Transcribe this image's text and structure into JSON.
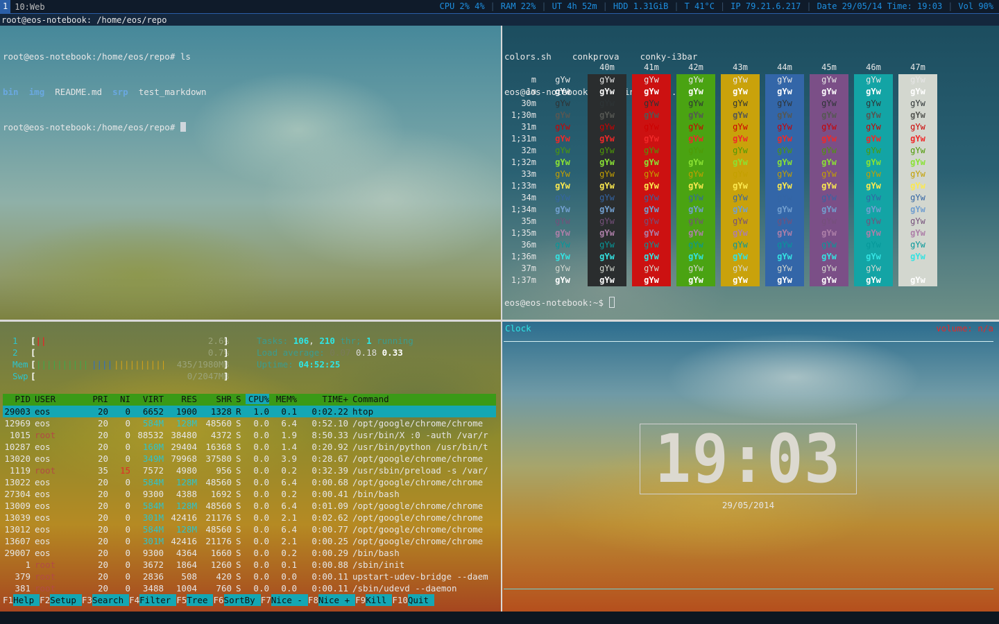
{
  "topbar": {
    "workspace_num": "1",
    "workspace_name": "10:Web",
    "status": [
      "CPU 2% 4%",
      "RAM 22%",
      "UT 4h 52m",
      "HDD 1.31GiB",
      "T 41°C",
      "IP 79.21.6.217",
      "Date 29/05/14 Time: 19:03",
      "Vol 90%"
    ],
    "separator": "|"
  },
  "titlebar": {
    "text": "root@eos-notebook: /home/eos/repo"
  },
  "term1": {
    "line1": "root@eos-notebook:/home/eos/repo# ls",
    "ls_dirs": [
      "bin",
      "img"
    ],
    "ls_file1": "README.md",
    "ls_dir3": "srp",
    "ls_file2": "test_markdown",
    "line3": "root@eos-notebook:/home/eos/repo# "
  },
  "term2": {
    "files": "colors.sh    conkprova    conky-i3bar",
    "cmd": "eos@eos-notebook:~$ ./bin/colors.sh",
    "prompt": "eos@eos-notebook:~$ "
  },
  "colors": {
    "sample": "gYw",
    "bg_headers": [
      "40m",
      "41m",
      "42m",
      "43m",
      "44m",
      "45m",
      "46m",
      "47m"
    ],
    "bg_colors": [
      "#2a2d2e",
      "#cc1111",
      "#4aa312",
      "#c9a20b",
      "#3366a8",
      "#7b4f87",
      "#13a4a5",
      "#d3d7cf"
    ],
    "rows": [
      {
        "label": "m",
        "fg": "#e6e6e6",
        "bold": false
      },
      {
        "label": "1m",
        "fg": "#ffffff",
        "bold": true
      },
      {
        "label": "30m",
        "fg": "#2e3436",
        "bold": false
      },
      {
        "label": "1;30m",
        "fg": "#555753",
        "bold": true
      },
      {
        "label": "31m",
        "fg": "#cc0000",
        "bold": false
      },
      {
        "label": "1;31m",
        "fg": "#ef2929",
        "bold": true
      },
      {
        "label": "32m",
        "fg": "#4e9a06",
        "bold": false
      },
      {
        "label": "1;32m",
        "fg": "#8ae234",
        "bold": true
      },
      {
        "label": "33m",
        "fg": "#c4a000",
        "bold": false
      },
      {
        "label": "1;33m",
        "fg": "#fce94f",
        "bold": true
      },
      {
        "label": "34m",
        "fg": "#3465a4",
        "bold": false
      },
      {
        "label": "1;34m",
        "fg": "#729fcf",
        "bold": true
      },
      {
        "label": "35m",
        "fg": "#75507b",
        "bold": false
      },
      {
        "label": "1;35m",
        "fg": "#ad7fa8",
        "bold": true
      },
      {
        "label": "36m",
        "fg": "#06989a",
        "bold": false
      },
      {
        "label": "1;36m",
        "fg": "#34e2e2",
        "bold": true
      },
      {
        "label": "37m",
        "fg": "#d3d7cf",
        "bold": false
      },
      {
        "label": "1;37m",
        "fg": "#ffffff",
        "bold": true
      }
    ]
  },
  "htop": {
    "cpu1_label": "1",
    "cpu2_label": "2",
    "mem_label": "Mem",
    "swp_label": "Swp",
    "cpu1_value": "2.6%",
    "cpu2_value": "0.7%",
    "mem_value": "435/1980MB",
    "swp_value": "0/2047MB",
    "tasks_label": "Tasks:",
    "tasks_count": "106",
    "thr_count": "210",
    "thr_label": "thr;",
    "running_count": "1",
    "running_label": "running",
    "load_label": "Load average:",
    "load1": "0.07",
    "load5": "0.18",
    "load15": "0.33",
    "uptime_label": "Uptime:",
    "uptime": "04:52:25",
    "columns": [
      "PID",
      "USER",
      "PRI",
      "NI",
      "VIRT",
      "RES",
      "SHR",
      "S",
      "CPU%",
      "MEM%",
      "TIME+",
      "Command"
    ],
    "processes": [
      {
        "pid": "29003",
        "user": "eos",
        "pri": "20",
        "ni": "0",
        "virt": "6652",
        "res": "1900",
        "shr": "1328",
        "s": "R",
        "cpu": "1.0",
        "mem": "0.1",
        "time": "0:02.22",
        "cmd": "htop"
      },
      {
        "pid": "12969",
        "user": "eos",
        "pri": "20",
        "ni": "0",
        "virt": "584M",
        "res": "128M",
        "shr": "48560",
        "s": "S",
        "cpu": "0.0",
        "mem": "6.4",
        "time": "0:52.10",
        "cmd": "/opt/google/chrome/chrome"
      },
      {
        "pid": "1015",
        "user": "root",
        "pri": "20",
        "ni": "0",
        "virt": "88532",
        "res": "38480",
        "shr": "4372",
        "s": "S",
        "cpu": "0.0",
        "mem": "1.9",
        "time": "8:50.33",
        "cmd": "/usr/bin/X :0 -auth /var/r"
      },
      {
        "pid": "10287",
        "user": "eos",
        "pri": "20",
        "ni": "0",
        "virt": "160M",
        "res": "29404",
        "shr": "16368",
        "s": "S",
        "cpu": "0.0",
        "mem": "1.4",
        "time": "0:20.92",
        "cmd": "/usr/bin/python /usr/bin/t"
      },
      {
        "pid": "13020",
        "user": "eos",
        "pri": "20",
        "ni": "0",
        "virt": "349M",
        "res": "79968",
        "shr": "37580",
        "s": "S",
        "cpu": "0.0",
        "mem": "3.9",
        "time": "0:28.67",
        "cmd": "/opt/google/chrome/chrome"
      },
      {
        "pid": "1119",
        "user": "root",
        "pri": "35",
        "ni": "15",
        "virt": "7572",
        "res": "4980",
        "shr": "956",
        "s": "S",
        "cpu": "0.0",
        "mem": "0.2",
        "time": "0:32.39",
        "cmd": "/usr/sbin/preload -s /var/"
      },
      {
        "pid": "13022",
        "user": "eos",
        "pri": "20",
        "ni": "0",
        "virt": "584M",
        "res": "128M",
        "shr": "48560",
        "s": "S",
        "cpu": "0.0",
        "mem": "6.4",
        "time": "0:00.68",
        "cmd": "/opt/google/chrome/chrome"
      },
      {
        "pid": "27304",
        "user": "eos",
        "pri": "20",
        "ni": "0",
        "virt": "9300",
        "res": "4388",
        "shr": "1692",
        "s": "S",
        "cpu": "0.0",
        "mem": "0.2",
        "time": "0:00.41",
        "cmd": "/bin/bash"
      },
      {
        "pid": "13009",
        "user": "eos",
        "pri": "20",
        "ni": "0",
        "virt": "584M",
        "res": "128M",
        "shr": "48560",
        "s": "S",
        "cpu": "0.0",
        "mem": "6.4",
        "time": "0:01.09",
        "cmd": "/opt/google/chrome/chrome"
      },
      {
        "pid": "13039",
        "user": "eos",
        "pri": "20",
        "ni": "0",
        "virt": "301M",
        "res": "42416",
        "shr": "21176",
        "s": "S",
        "cpu": "0.0",
        "mem": "2.1",
        "time": "0:02.62",
        "cmd": "/opt/google/chrome/chrome"
      },
      {
        "pid": "13012",
        "user": "eos",
        "pri": "20",
        "ni": "0",
        "virt": "584M",
        "res": "128M",
        "shr": "48560",
        "s": "S",
        "cpu": "0.0",
        "mem": "6.4",
        "time": "0:00.77",
        "cmd": "/opt/google/chrome/chrome"
      },
      {
        "pid": "13607",
        "user": "eos",
        "pri": "20",
        "ni": "0",
        "virt": "301M",
        "res": "42416",
        "shr": "21176",
        "s": "S",
        "cpu": "0.0",
        "mem": "2.1",
        "time": "0:00.25",
        "cmd": "/opt/google/chrome/chrome"
      },
      {
        "pid": "29007",
        "user": "eos",
        "pri": "20",
        "ni": "0",
        "virt": "9300",
        "res": "4364",
        "shr": "1660",
        "s": "S",
        "cpu": "0.0",
        "mem": "0.2",
        "time": "0:00.29",
        "cmd": "/bin/bash"
      },
      {
        "pid": "1",
        "user": "root",
        "pri": "20",
        "ni": "0",
        "virt": "3672",
        "res": "1864",
        "shr": "1260",
        "s": "S",
        "cpu": "0.0",
        "mem": "0.1",
        "time": "0:00.88",
        "cmd": "/sbin/init"
      },
      {
        "pid": "379",
        "user": "root",
        "pri": "20",
        "ni": "0",
        "virt": "2836",
        "res": "508",
        "shr": "420",
        "s": "S",
        "cpu": "0.0",
        "mem": "0.0",
        "time": "0:00.11",
        "cmd": "upstart-udev-bridge --daem"
      },
      {
        "pid": "381",
        "user": "root",
        "pri": "20",
        "ni": "0",
        "virt": "3488",
        "res": "1004",
        "shr": "760",
        "s": "S",
        "cpu": "0.0",
        "mem": "0.0",
        "time": "0:00.11",
        "cmd": "/sbin/udevd --daemon"
      }
    ],
    "fkeys": [
      {
        "key": "F1",
        "label": "Help"
      },
      {
        "key": "F2",
        "label": "Setup"
      },
      {
        "key": "F3",
        "label": "Search"
      },
      {
        "key": "F4",
        "label": "Filter"
      },
      {
        "key": "F5",
        "label": "Tree"
      },
      {
        "key": "F6",
        "label": "SortBy"
      },
      {
        "key": "F7",
        "label": "Nice -"
      },
      {
        "key": "F8",
        "label": "Nice +"
      },
      {
        "key": "F9",
        "label": "Kill"
      },
      {
        "key": "F10",
        "label": "Quit"
      }
    ]
  },
  "clock": {
    "title": "Clock",
    "volume": "volume: n/a",
    "time": "19:03",
    "date": "29/05/2014"
  }
}
